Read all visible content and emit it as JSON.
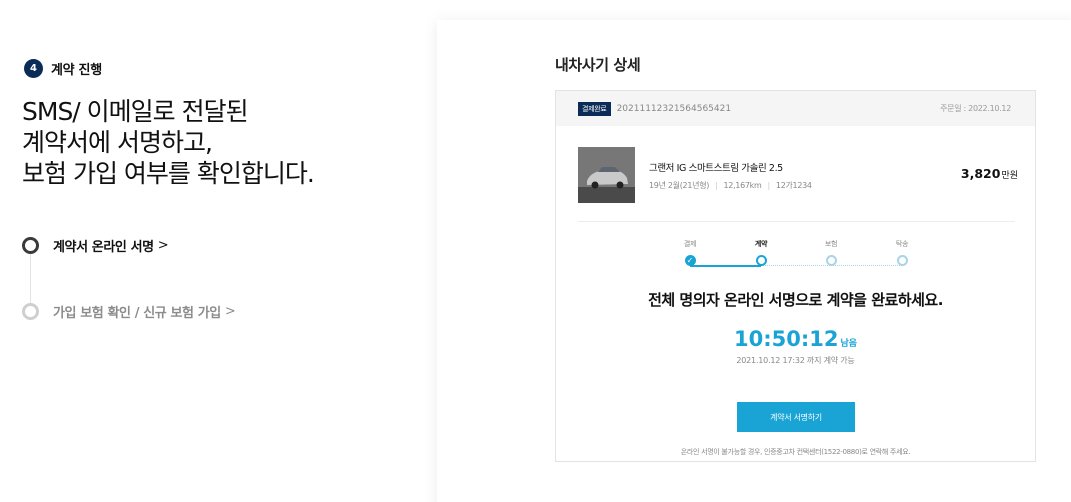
{
  "left": {
    "step_number": "4",
    "step_title": "계약 진행",
    "headline": [
      "SMS/ 이메일로 전달된",
      "계약서에 서명하고,",
      "보험 가입 여부를 확인합니다."
    ],
    "options": [
      {
        "label": "계약서 온라인 서명",
        "chevron": ">",
        "state": "active"
      },
      {
        "label": "가입 보험 확인 / 신규 보험 가입",
        "chevron": ">",
        "state": "inactive"
      }
    ]
  },
  "card": {
    "title": "내차사기 상세",
    "badge": "결제완료",
    "order_number": "20211112321564565421",
    "order_date": "주문일 : 2022.10.12",
    "car": {
      "name": "그랜저 IG 스마트스트림 가솔린 2.5",
      "year": "19년 2월(21년형)",
      "mileage": "12,167km",
      "plate": "12가1234",
      "price": "3,820",
      "price_unit": "만원"
    },
    "stages": [
      {
        "label": "결제",
        "status": "done"
      },
      {
        "label": "계약",
        "status": "current"
      },
      {
        "label": "보험",
        "status": "todo"
      },
      {
        "label": "탁송",
        "status": "todo"
      }
    ],
    "message": "전체 명의자 온라인 서명으로 계약을 완료하세요.",
    "timer": "10:50:12",
    "timer_suffix": "남음",
    "deadline": "2021.10.12 17:32 까지 계약 가능",
    "sign_button": "계약서 서명하기",
    "note": "온라인 서명이 불가능할 경우, 인증중고차 컨택센터(1522-0880)로 연락해 주세요."
  },
  "colors": {
    "navy": "#0a2c57",
    "accent": "#1aa3d5"
  }
}
